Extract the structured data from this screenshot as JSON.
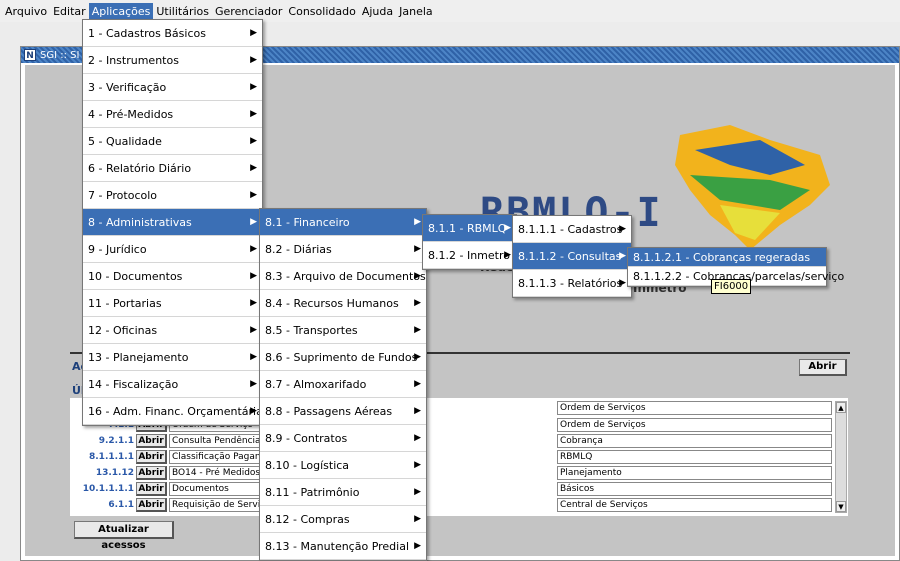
{
  "menubar": [
    "Arquivo",
    "Editar",
    "Aplicações",
    "Utilitários",
    "Gerenciador",
    "Consolidado",
    "Ajuda",
    "Janela"
  ],
  "window_title": "SGI :: SI",
  "window_icon": "N",
  "logo": {
    "main": "RBMLQ-I",
    "sub": "Rede",
    "sub2": "Inmetro"
  },
  "labels": {
    "acessos_prefix": "Ac",
    "ultimos_prefix": "Úl"
  },
  "abrir_label": "Abrir",
  "atualizar_label": "Atualizar acessos",
  "rows": [
    {
      "code": "",
      "name": "",
      "right": "Ordem de Serviços"
    },
    {
      "code": "7.1.1",
      "name": "Ordem de Serviço",
      "right": "Ordem de Serviços"
    },
    {
      "code": "9.2.1.1",
      "name": "Consulta Pendência",
      "right": "Cobrança"
    },
    {
      "code": "8.1.1.1.1",
      "name": "Classificação Pagan",
      "right": "RBMLQ"
    },
    {
      "code": "13.1.12",
      "name": "BO14 - Pré Medidos",
      "right": "Planejamento"
    },
    {
      "code": "10.1.1.1.1",
      "name": "Documentos",
      "right": "Básicos"
    },
    {
      "code": "6.1.1",
      "name": "Requisição de Servi",
      "right": "Central de Serviços"
    }
  ],
  "menu1": [
    "1 - Cadastros Básicos",
    "2 - Instrumentos",
    "3 - Verificação",
    "4 - Pré-Medidos",
    "5 - Qualidade",
    "6 - Relatório Diário",
    "7 - Protocolo",
    "8 - Administrativas",
    "9 - Jurídico",
    "10 - Documentos",
    "11 - Portarias",
    "12 - Oficinas",
    "13 - Planejamento",
    "14 - Fiscalização",
    "16 - Adm. Financ. Orçamentária"
  ],
  "menu2": [
    "8.1 - Financeiro",
    "8.2 - Diárias",
    "8.3 - Arquivo de Documentos",
    "8.4 - Recursos Humanos",
    "8.5 - Transportes",
    "8.6 - Suprimento de Fundos",
    "8.7 - Almoxarifado",
    "8.8 - Passagens Aéreas",
    "8.9 - Contratos",
    "8.10 - Logística",
    "8.11 - Patrimônio",
    "8.12 - Compras",
    "8.13 - Manutenção Predial"
  ],
  "menu3": [
    "8.1.1 - RBMLQ",
    "8.1.2 - Inmetro"
  ],
  "menu4": [
    "8.1.1.1 - Cadastros",
    "8.1.1.2 - Consultas",
    "8.1.1.3 - Relatórios"
  ],
  "menu5": [
    "8.1.1.2.1 - Cobranças regeradas",
    "8.1.1.2.2 - Cobranças/parcelas/serviço"
  ],
  "tooltip": "FI6000",
  "colors": {
    "accent": "#3b6fb5",
    "window_title": "#2f62a7",
    "code_text": "#2a58a8"
  }
}
